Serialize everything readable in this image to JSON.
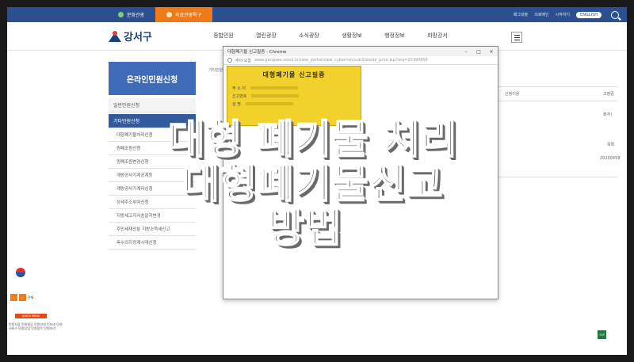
{
  "topbar": {
    "tabs": [
      {
        "label": "문화관광"
      },
      {
        "label": "의료관광특구"
      }
    ],
    "links": [
      "페그대출",
      "의뢰메인",
      "시작하기"
    ],
    "english": "ENGLISH"
  },
  "header": {
    "logo": "강서구",
    "nav": [
      "종합민원",
      "열린광장",
      "소식광장",
      "생활정보",
      "행정정보",
      "희망강서"
    ]
  },
  "sidebar": {
    "title": "온라인민원신청",
    "sub1": "일반민원신청",
    "sub2": "기타민원신청",
    "items": [
      "대형폐기물처리신청",
      "원폐조원신청",
      "원폐조원변경신청",
      "계량공사기계공계등",
      "계량공사기계리신청",
      "상세주소부여신청",
      "지방세고지서송달지변경",
      "주민세재산분 지방소득세신고",
      "옥수의지정계시대신청"
    ]
  },
  "content": {
    "snippet_top": "기타민원",
    "snippet_r1": "신청이용",
    "snippet_r2": "고정중",
    "snippet_r3": "20200459",
    "snippet_r4": "목록",
    "snippet_r5": "출자)"
  },
  "popup": {
    "window_title": "대형폐기물 신고필증 - Chrome",
    "url_label": "주의 요함",
    "url": "www.gangseo.seoul.kr/new_portal/view_cybermin/sub3/waste_print.jsp?seq=20190806",
    "card_title": "대형폐기물 신고필증",
    "card_rows": [
      "주 소 지",
      "신고번호",
      "성    명"
    ]
  },
  "widgets": {
    "mini_label": "전체",
    "quick_label": "QUICK MENU",
    "footer_text": "민원서류 민원발급 민원안내 인터넷 민원서비스 민원상담 민원접수 민원처리",
    "top_label": "TOP"
  },
  "headline": {
    "line1": "대형 폐기물 처리",
    "line2": "대형폐기물신고",
    "line3": "방법"
  },
  "colors": {
    "topbar": "#2d4f8f",
    "accent_orange": "#f07a1a",
    "sidebar_blue": "#3f6bb8",
    "card_yellow": "#f3d12c"
  }
}
